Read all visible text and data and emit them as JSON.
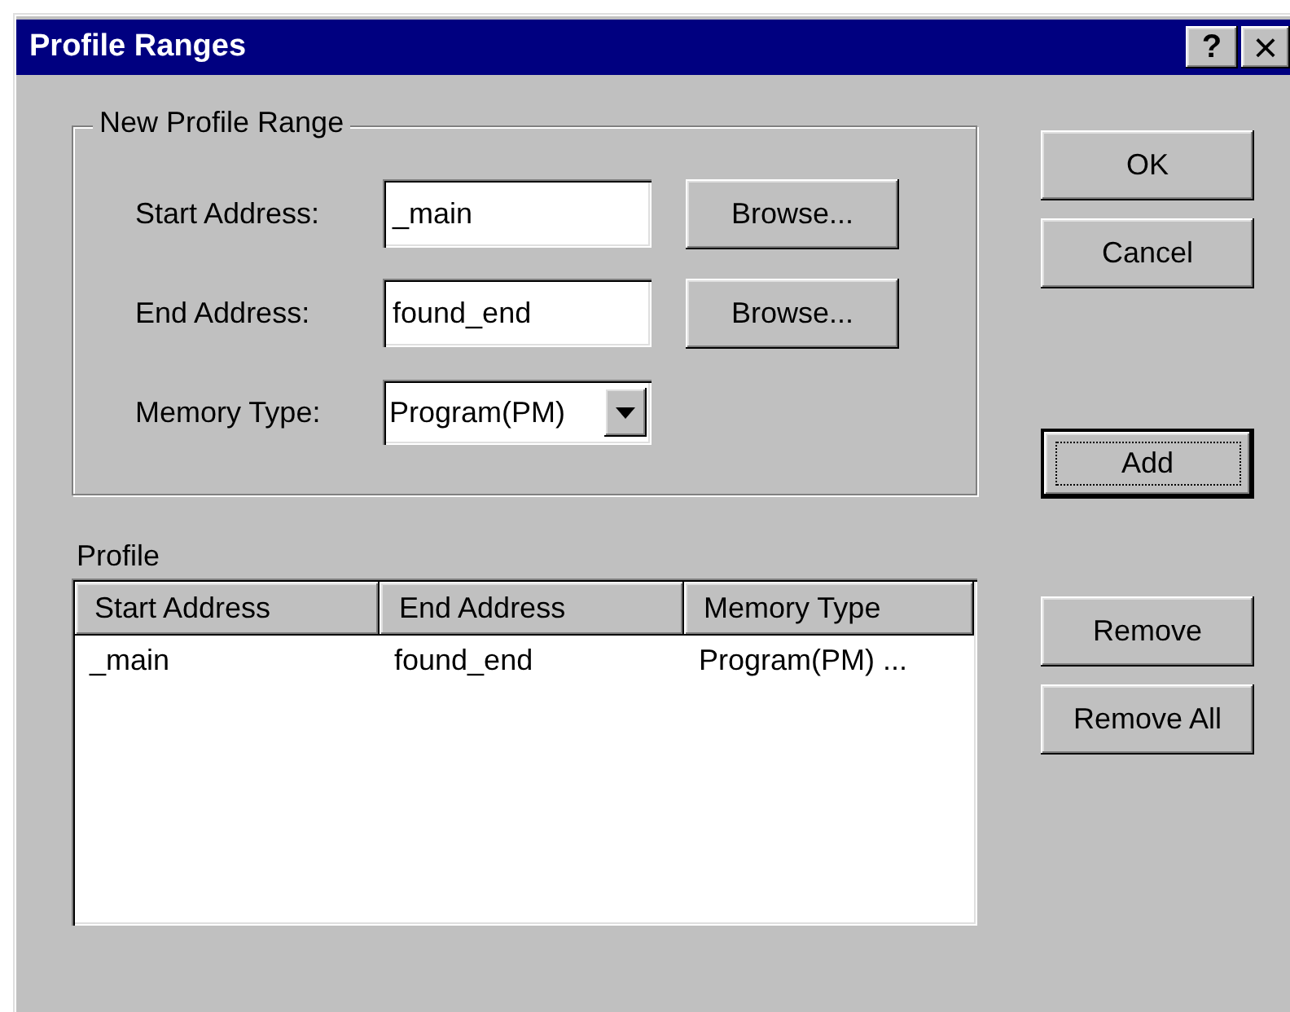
{
  "window": {
    "title": "Profile Ranges",
    "title_buttons": [
      {
        "kind": "help",
        "label": "?"
      },
      {
        "kind": "close",
        "label": "×"
      }
    ]
  },
  "new_profile_range": {
    "title": "New Profile Range",
    "fields": [
      {
        "kind": "text",
        "label": "Start Address:",
        "value": "_main",
        "button": {
          "label": "Browse..."
        }
      },
      {
        "kind": "text",
        "label": "End Address:",
        "value": "found_end",
        "button": {
          "label": "Browse..."
        }
      },
      {
        "kind": "dropdown",
        "label": "Memory Type:",
        "value": "Program(PM)"
      }
    ]
  },
  "profile": {
    "label": "Profile",
    "columns": [
      "Start Address",
      "End Address",
      "Memory Type"
    ],
    "rows": [
      [
        "_main",
        "found_end",
        "Program(PM) ..."
      ]
    ]
  },
  "buttons": [
    {
      "label": "OK",
      "focused": false
    },
    {
      "label": "Cancel",
      "focused": false
    },
    {
      "label": "Add",
      "focused": true
    },
    {
      "label": "Remove",
      "focused": false
    },
    {
      "label": "Remove All",
      "focused": false
    }
  ]
}
